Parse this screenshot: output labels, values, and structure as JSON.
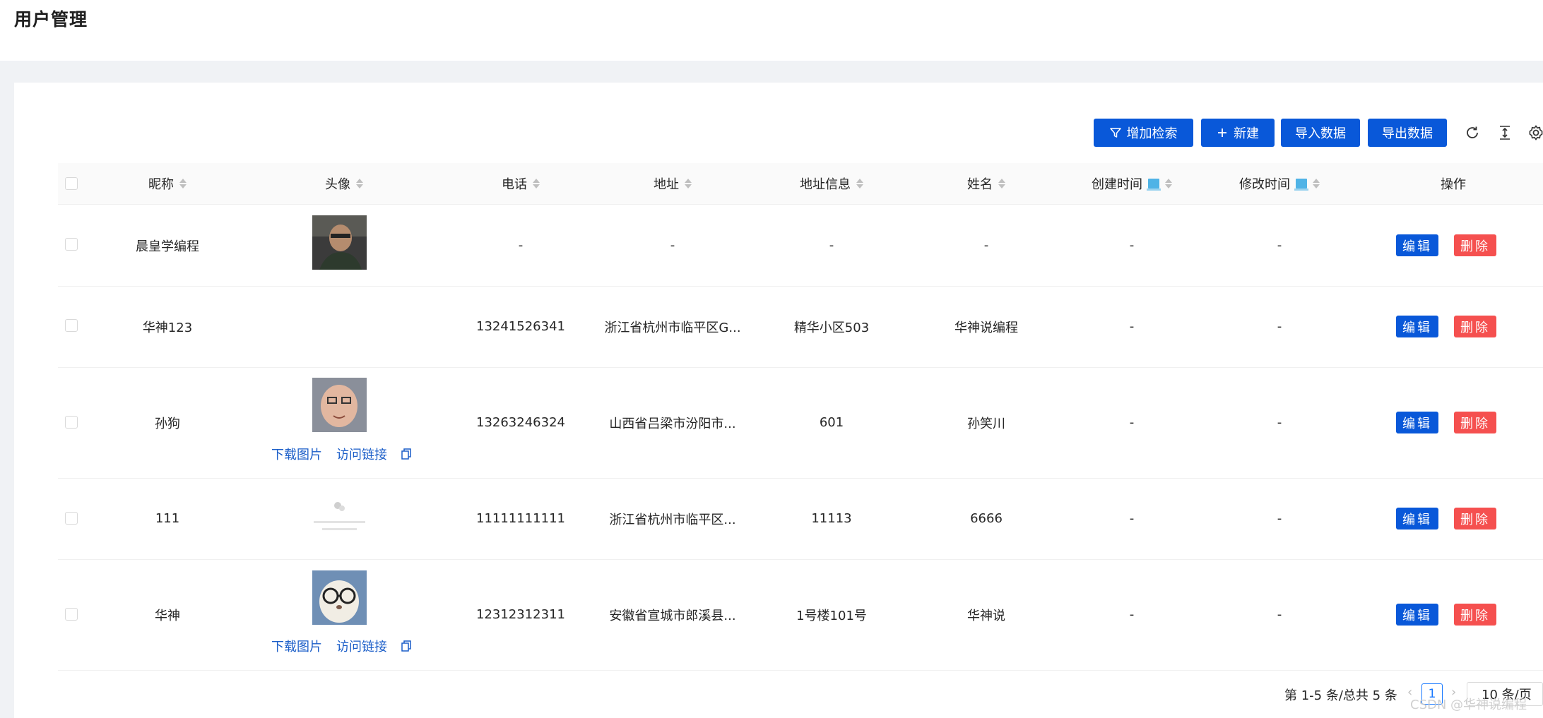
{
  "page": {
    "title": "用户管理"
  },
  "toolbar": {
    "search_label": "增加检索",
    "new_label": "新建",
    "import_label": "导入数据",
    "export_label": "导出数据"
  },
  "table": {
    "columns": [
      "昵称",
      "头像",
      "电话",
      "地址",
      "地址信息",
      "姓名",
      "创建时间",
      "修改时间",
      "操作"
    ],
    "rows": [
      {
        "nickname": "晨皇学编程",
        "phone": "-",
        "address": "-",
        "address_info": "-",
        "name": "-",
        "created": "-",
        "modified": "-",
        "avatar": "photo-man",
        "links": false
      },
      {
        "nickname": "华神123",
        "phone": "13241526341",
        "address": "浙江省杭州市临平区G...",
        "address_info": "精华小区503",
        "name": "华神说编程",
        "created": "-",
        "modified": "-",
        "avatar": "none",
        "links": false
      },
      {
        "nickname": "孙狗",
        "phone": "13263246324",
        "address": "山西省吕梁市汾阳市...",
        "address_info": "601",
        "name": "孙笑川",
        "created": "-",
        "modified": "-",
        "avatar": "photo-face",
        "links": true
      },
      {
        "nickname": "111",
        "phone": "11111111111",
        "address": "浙江省杭州市临平区...",
        "address_info": "11113",
        "name": "6666",
        "created": "-",
        "modified": "-",
        "avatar": "placeholder",
        "links": false
      },
      {
        "nickname": "华神",
        "phone": "12312312311",
        "address": "安徽省宣城市郎溪县...",
        "address_info": "1号楼101号",
        "name": "华神说",
        "created": "-",
        "modified": "-",
        "avatar": "photo-cat",
        "links": true
      }
    ],
    "link_download": "下载图片",
    "link_visit": "访问链接",
    "edit_label": "编辑",
    "delete_label": "删除"
  },
  "pagination": {
    "summary": "第 1-5 条/总共 5 条",
    "current_page": "1",
    "page_size": "10 条/页"
  },
  "watermark": "CSDN @华神说编程",
  "colors": {
    "primary": "#0958d9",
    "danger": "#f5504f",
    "link": "#1a5dc8",
    "background": "#f0f2f5"
  }
}
